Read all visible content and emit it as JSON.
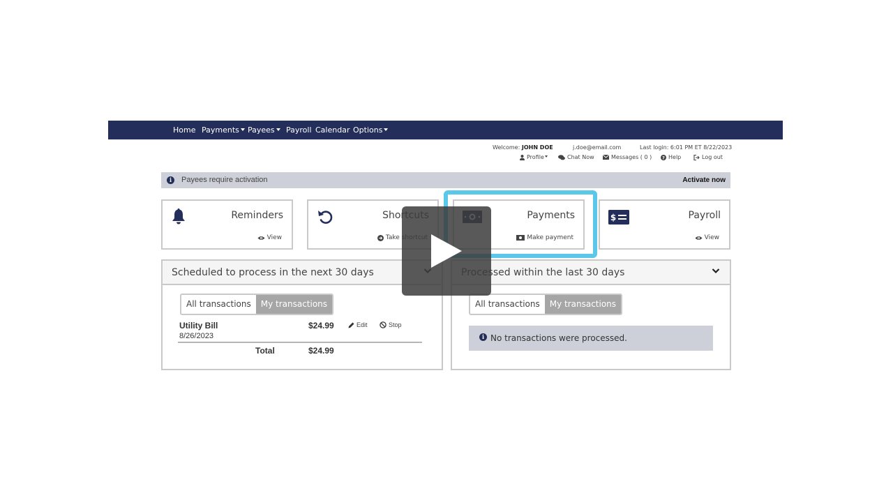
{
  "nav": {
    "items": [
      {
        "label": "Home",
        "dropdown": false
      },
      {
        "label": "Payments",
        "dropdown": true
      },
      {
        "label": "Payees",
        "dropdown": true
      },
      {
        "label": "Payroll",
        "dropdown": false
      },
      {
        "label": "Calendar",
        "dropdown": false
      },
      {
        "label": "Options",
        "dropdown": true
      }
    ],
    "bg_color": "#232e5a"
  },
  "user": {
    "welcome_label": "Welcome:",
    "name": "JOHN DOE",
    "email": "j.doe@email.com",
    "last_login": "Last login: 6:01 PM ET  8/22/2023",
    "links": {
      "profile": "Profile",
      "chat": "Chat Now",
      "messages": "Messages ( 0 )",
      "help": "Help",
      "logout": "Log out"
    }
  },
  "alert": {
    "text": "Payees require activation",
    "action": "Activate now",
    "icon": "info-circle-icon"
  },
  "cards": {
    "reminders": {
      "title": "Reminders",
      "action": "View",
      "icon": "bell-icon"
    },
    "shortcuts": {
      "title": "Shortcuts",
      "action": "Take shortcut",
      "icon": "undo-icon"
    },
    "payments": {
      "title": "Payments",
      "action": "Make payment",
      "icon": "money-icon",
      "highlighted": true,
      "highlight_color": "#5bc8ea"
    },
    "payroll": {
      "title": "Payroll",
      "action": "View",
      "icon": "check-dollar-icon"
    }
  },
  "scheduled": {
    "title": "Scheduled to process in the next 30 days",
    "toggle": {
      "all": "All transactions",
      "mine": "My transactions",
      "selected": "mine"
    },
    "transactions": [
      {
        "payee": "Utility Bill",
        "date": "8/26/2023",
        "amount": "$24.99",
        "edit": "Edit",
        "stop": "Stop"
      }
    ],
    "total_label": "Total",
    "total_amount": "$24.99"
  },
  "processed": {
    "title": "Processed within the last 30 days",
    "toggle": {
      "all": "All transactions",
      "mine": "My transactions",
      "selected": "mine"
    },
    "empty_message": "No transactions were processed."
  },
  "video_overlay": {
    "icon": "play-icon"
  }
}
